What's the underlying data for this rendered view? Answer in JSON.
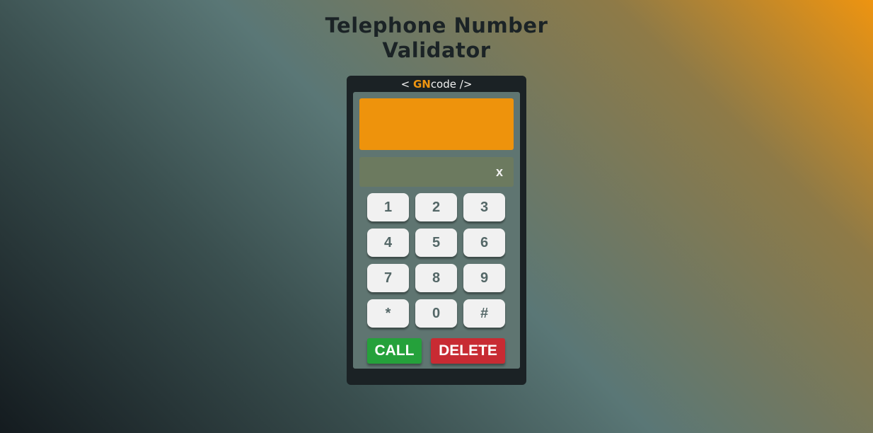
{
  "page": {
    "title_line1": "Telephone Number",
    "title_line2": "Validator"
  },
  "brand": {
    "prefix": "<",
    "gn": "GN",
    "code": "code",
    "suffix": "/>"
  },
  "input": {
    "value": "",
    "placeholder": "",
    "clear_label": "x"
  },
  "keypad": {
    "keys": [
      "1",
      "2",
      "3",
      "4",
      "5",
      "6",
      "7",
      "8",
      "9",
      "*",
      "0",
      "#"
    ]
  },
  "actions": {
    "call_label": "CALL",
    "delete_label": "DELETE"
  },
  "colors": {
    "accent": "#ee9410",
    "call": "#25a13b",
    "delete": "#c82b33"
  }
}
